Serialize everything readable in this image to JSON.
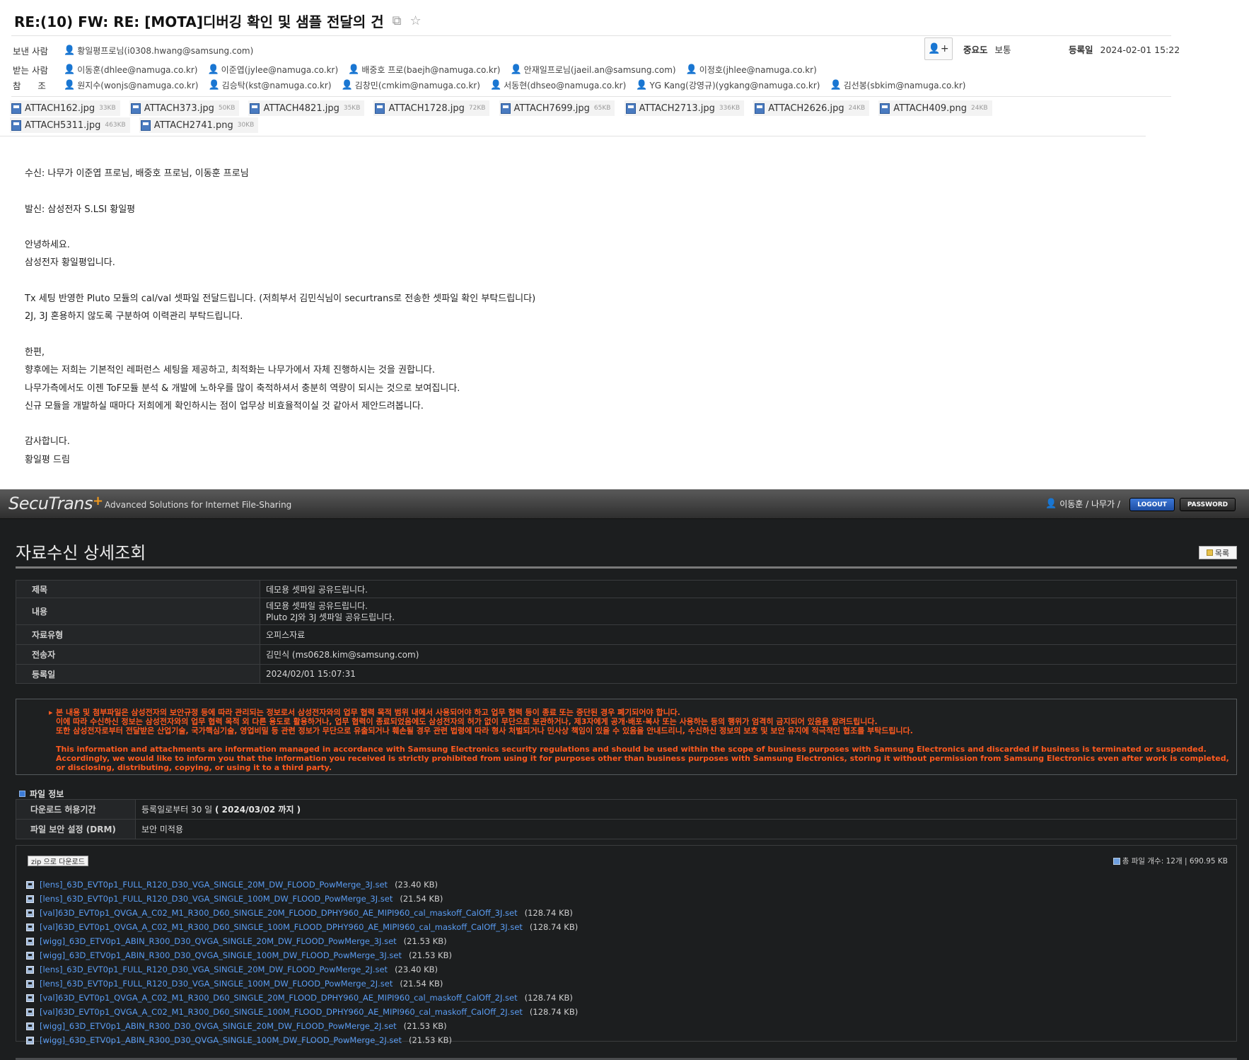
{
  "email": {
    "subject": "RE:(10) FW: RE: [MOTA]디버깅 확인 및 샘플 전달의 건",
    "from_label": "보낸 사람",
    "from": "황일평프로님(i0308.hwang@samsung.com)",
    "to_label": "받는 사람",
    "to": [
      "이동훈(dhlee@namuga.co.kr)",
      "이준엽(jylee@namuga.co.kr)",
      "배중호 프로(baejh@namuga.co.kr)",
      "안재일프로님(jaeil.an@samsung.com)",
      "이정호(jhlee@namuga.co.kr)"
    ],
    "cc_label": "참      조",
    "cc": [
      "원지수(wonjs@namuga.co.kr)",
      "김승탁(kst@namuga.co.kr)",
      "김창민(cmkim@namuga.co.kr)",
      "서동현(dhseo@namuga.co.kr)",
      "YG Kang(강영규)(ygkang@namuga.co.kr)",
      "김선봉(sbkim@namuga.co.kr)"
    ],
    "importance_label": "중요도",
    "importance_value": "보통",
    "date_label": "등록일",
    "date_value": "2024-02-01 15:22",
    "attachments": [
      {
        "name": "ATTACH162.jpg",
        "size": "33KB"
      },
      {
        "name": "ATTACH373.jpg",
        "size": "50KB"
      },
      {
        "name": "ATTACH4821.jpg",
        "size": "35KB"
      },
      {
        "name": "ATTACH1728.jpg",
        "size": "72KB"
      },
      {
        "name": "ATTACH7699.jpg",
        "size": "65KB"
      },
      {
        "name": "ATTACH2713.jpg",
        "size": "336KB"
      },
      {
        "name": "ATTACH2626.jpg",
        "size": "24KB"
      },
      {
        "name": "ATTACH409.png",
        "size": "24KB"
      },
      {
        "name": "ATTACH5311.jpg",
        "size": "463KB"
      },
      {
        "name": "ATTACH2741.png",
        "size": "30KB"
      }
    ],
    "body_lines": [
      "수신: 나무가 이준엽 프로님, 배중호 프로님, 이동훈 프로님",
      "",
      "발신: 삼성전자 S.LSI 황일평",
      "",
      "안녕하세요.",
      "삼성전자 황일평입니다.",
      "",
      "Tx 세팅 반영한 Pluto 모듈의 cal/val 셋파일 전달드립니다. (저희부서 김민식님이 securtrans로 전송한 셋파일 확인 부탁드립니다)",
      "2J, 3J 혼용하지 않도록 구분하여 이력관리 부탁드립니다.",
      "",
      "한편,",
      "향후에는 저희는 기본적인 레퍼런스 세팅을 제공하고, 최적화는 나무가에서 자체 진행하시는 것을 권합니다.",
      "나무가측에서도 이젠 ToF모듈 분석 & 개발에 노하우를 많이 축적하셔서 충분히 역량이 되시는 것으로 보여집니다.",
      "신규 모듈을 개발하실 때마다 저희에게 확인하시는 점이 업무상 비효율적이실 것 같아서 제안드려봅니다.",
      "",
      "감사합니다.",
      "황일평 드림"
    ]
  },
  "secutrans": {
    "logo": "SecuTrans",
    "logo_plus": "+",
    "tagline": "Advanced Solutions for Internet File-Sharing",
    "user": "이동훈 / 나무가 /",
    "logout": "LOGOUT",
    "password": "PASSWORD",
    "page_title": "자료수신 상세조회",
    "list_button": "목록",
    "details": {
      "title_label": "제목",
      "title_value": "데모용 셋파일 공유드립니다.",
      "content_label": "내용",
      "content_line1": "데모용 셋파일 공유드립니다.",
      "content_line2": "Pluto 2J와 3J 셋파일 공유드립니다.",
      "type_label": "자료유형",
      "type_value": "오피스자료",
      "sender_label": "전송자",
      "sender_value": "김민식 (ms0628.kim@samsung.com)",
      "date_label": "등록일",
      "date_value": "2024/02/01 15:07:31"
    },
    "warning_kr_1": "본 내용 및 첨부파일은 삼성전자의 보안규정 등에 따라 관리되는 정보로서 삼성전자와의 업무 협력 목적 범위 내에서 사용되어야 하고 업무 협력 등이 종료 또는 중단된 경우 폐기되어야 합니다.",
    "warning_kr_2": "이에 따라 수신하신 정보는 삼성전자와의 업무 협력 목적 외 다른 용도로 활용하거나, 업무 협력이 종료되었음에도 삼성전자의 허가 없이 무단으로 보관하거나, 제3자에게 공개·배포·복사 또는 사용하는 등의 행위가 엄격히 금지되어 있음을 알려드립니다.",
    "warning_kr_3": "또한 삼성전자로부터 전달받은 산업기술, 국가핵심기술, 영업비밀 등 관련 정보가 무단으로 유출되거나 훼손될 경우 관련 법령에 따라 형사 처벌되거나 민사상 책임이 있을 수 있음을 안내드리니, 수신하신 정보의 보호 및 보안 유지에 적극적인 협조를 부탁드립니다.",
    "warning_en": "This information and attachments are information managed in accordance with Samsung Electronics security regulations and should be used within the scope of business purposes with Samsung Electronics and discarded if business is terminated or suspended. Accordingly, we would like to inform you that the information you received is strictly prohibited from using it for purposes other than business purposes with Samsung Electronics, storing it without permission from Samsung Electronics even after work is completed, or disclosing, distributing, copying, or using it to a third party.",
    "file_section_title": "파일 정보",
    "download_period_label": "다운로드 허용기간",
    "download_period_value": "등록일로부터 30 일",
    "download_period_until": "( 2024/03/02 까지 )",
    "drm_label": "파일 보안 설정 (DRM)",
    "drm_value": "보안 미적용",
    "zip_button": "zip 으로 다운로드",
    "total_files": "총 파일 개수: 12개 | 690.95 KB",
    "files": [
      {
        "name": "[lens]_63D_EVT0p1_FULL_R120_D30_VGA_SINGLE_20M_DW_FLOOD_PowMerge_3J.set",
        "size": "(23.40 KB)"
      },
      {
        "name": "[lens]_63D_EVT0p1_FULL_R120_D30_VGA_SINGLE_100M_DW_FLOOD_PowMerge_3J.set",
        "size": "(21.54 KB)"
      },
      {
        "name": "[val]63D_EVT0p1_QVGA_A_C02_M1_R300_D60_SINGLE_20M_FLOOD_DPHY960_AE_MIPI960_cal_maskoff_CalOff_3J.set",
        "size": "(128.74 KB)"
      },
      {
        "name": "[val]63D_EVT0p1_QVGA_A_C02_M1_R300_D60_SINGLE_100M_FLOOD_DPHY960_AE_MIPI960_cal_maskoff_CalOff_3J.set",
        "size": "(128.74 KB)"
      },
      {
        "name": "[wigg]_63D_ETV0p1_ABIN_R300_D30_QVGA_SINGLE_20M_DW_FLOOD_PowMerge_3J.set",
        "size": "(21.53 KB)"
      },
      {
        "name": "[wigg]_63D_ETV0p1_ABIN_R300_D30_QVGA_SINGLE_100M_DW_FLOOD_PowMerge_3J.set",
        "size": "(21.53 KB)"
      },
      {
        "name": "[lens]_63D_EVT0p1_FULL_R120_D30_VGA_SINGLE_20M_DW_FLOOD_PowMerge_2J.set",
        "size": "(23.40 KB)"
      },
      {
        "name": "[lens]_63D_EVT0p1_FULL_R120_D30_VGA_SINGLE_100M_DW_FLOOD_PowMerge_2J.set",
        "size": "(21.54 KB)"
      },
      {
        "name": "[val]63D_EVT0p1_QVGA_A_C02_M1_R300_D60_SINGLE_20M_FLOOD_DPHY960_AE_MIPI960_cal_maskoff_CalOff_2J.set",
        "size": "(128.74 KB)"
      },
      {
        "name": "[val]63D_EVT0p1_QVGA_A_C02_M1_R300_D60_SINGLE_100M_FLOOD_DPHY960_AE_MIPI960_cal_maskoff_CalOff_2J.set",
        "size": "(128.74 KB)"
      },
      {
        "name": "[wigg]_63D_ETV0p1_ABIN_R300_D30_QVGA_SINGLE_20M_DW_FLOOD_PowMerge_2J.set",
        "size": "(21.53 KB)"
      },
      {
        "name": "[wigg]_63D_ETV0p1_ABIN_R300_D30_QVGA_SINGLE_100M_DW_FLOOD_PowMerge_2J.set",
        "size": "(21.53 KB)"
      }
    ]
  }
}
